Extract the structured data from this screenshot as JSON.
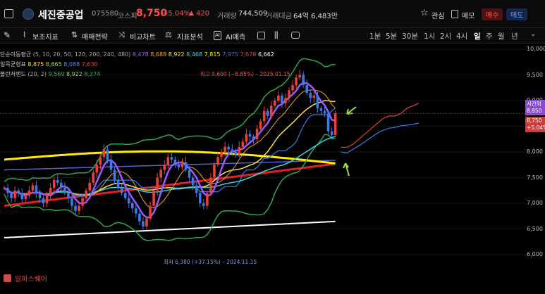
{
  "header": {
    "stock_name": "세진중공업",
    "stock_code": "075580",
    "market": "코스피",
    "price": "8,750",
    "change_pct": "+5.04%",
    "change_arrow": "▲",
    "change_amount": "420",
    "volume_label": "거래량",
    "volume_value": "744,509",
    "trade_value_label": "거래대금",
    "trade_value": "64억 6,483만",
    "interest_label": "관심",
    "memo_label": "메모",
    "buy_label": "매수",
    "sell_label": "매도"
  },
  "toolbar": {
    "tools": [
      "보조지표",
      "매매전략",
      "비교차트",
      "지표분석"
    ],
    "ai_label": "AI예측",
    "periods": [
      "1분",
      "5분",
      "30분",
      "1시",
      "2시",
      "4시",
      "일",
      "주",
      "월",
      "년"
    ],
    "selected_period": "일"
  },
  "legend": {
    "sma": {
      "label": "단순이동평균",
      "params": "(5, 10, 20, 50, 120, 200, 240, 480)",
      "values": [
        "8,478",
        "8,688",
        "8,922",
        "8,468",
        "7,815",
        "7,975",
        "7,678",
        "6,662"
      ],
      "colors": [
        "#9b59ff",
        "#f0a030",
        "#ffe14a",
        "#38d6e8",
        "#ffee00",
        "#5a62c8",
        "#e04040",
        "#ffffff"
      ]
    },
    "ichimoku": {
      "label": "일목균형표",
      "values": [
        "8,875",
        "8,665",
        "8,088",
        "7,630"
      ],
      "colors": [
        "#ffe14a",
        "#9be04a",
        "#5a8de0",
        "#e04040"
      ]
    },
    "bollinger": {
      "label": "볼린저밴드",
      "params": "(20, 2)",
      "values": [
        "9,569",
        "8,922",
        "8,274"
      ],
      "colors": [
        "#33b35a",
        "#9be04a",
        "#33b35a"
      ]
    }
  },
  "annotations": {
    "high": "최고 9,600 (−8.85%) – 2025.01.15",
    "low": "최저 6,380 (+37.15%) – 2024.11.15"
  },
  "axis": {
    "ticks": [
      "10,000",
      "9,500",
      "9,000",
      "8,500",
      "8,000",
      "7,500",
      "7,000",
      "6,500",
      "6,000"
    ],
    "time_tag": "시간외",
    "time_tag_value": "8,850",
    "price_tag": "8,750",
    "price_tag_change": "+5.04%"
  },
  "watermark": "알파스퀘어",
  "colors": {
    "up": "#e8413a",
    "down": "#3a7be8",
    "accent": "#ff6a3d"
  },
  "chart_data": {
    "type": "candlestick",
    "ylim": [
      6000,
      10000
    ],
    "close": [
      7300,
      7200,
      7100,
      7250,
      7200,
      7080,
      7150,
      7250,
      7350,
      7200,
      7100,
      7000,
      7150,
      7300,
      7450,
      7400,
      7300,
      7200,
      7100,
      6950,
      6850,
      6950,
      7100,
      7250,
      7400,
      7600,
      7750,
      7900,
      8050,
      7850,
      7650,
      7450,
      7300,
      7200,
      7100,
      7000,
      6900,
      6800,
      6650,
      6550,
      6700,
      6950,
      7250,
      7500,
      7650,
      7750,
      7900,
      7850,
      7750,
      7700,
      7800,
      7650,
      7500,
      7350,
      7200,
      7000,
      6950,
      7200,
      7500,
      7750,
      7900,
      8000,
      8100,
      8050,
      8000,
      7950,
      8100,
      8200,
      8350,
      8300,
      8250,
      8450,
      8600,
      8800,
      8700,
      8900,
      9000,
      9100,
      8950,
      9050,
      9200,
      9300,
      9450,
      9500,
      9300,
      9150,
      9050,
      9100,
      8850,
      8800,
      8750,
      8400,
      8330,
      8750
    ],
    "overlay_points": {
      "sma5_label": "8,478",
      "bb_upper_label": "9,569",
      "bb_lower_label": "8,274"
    }
  }
}
